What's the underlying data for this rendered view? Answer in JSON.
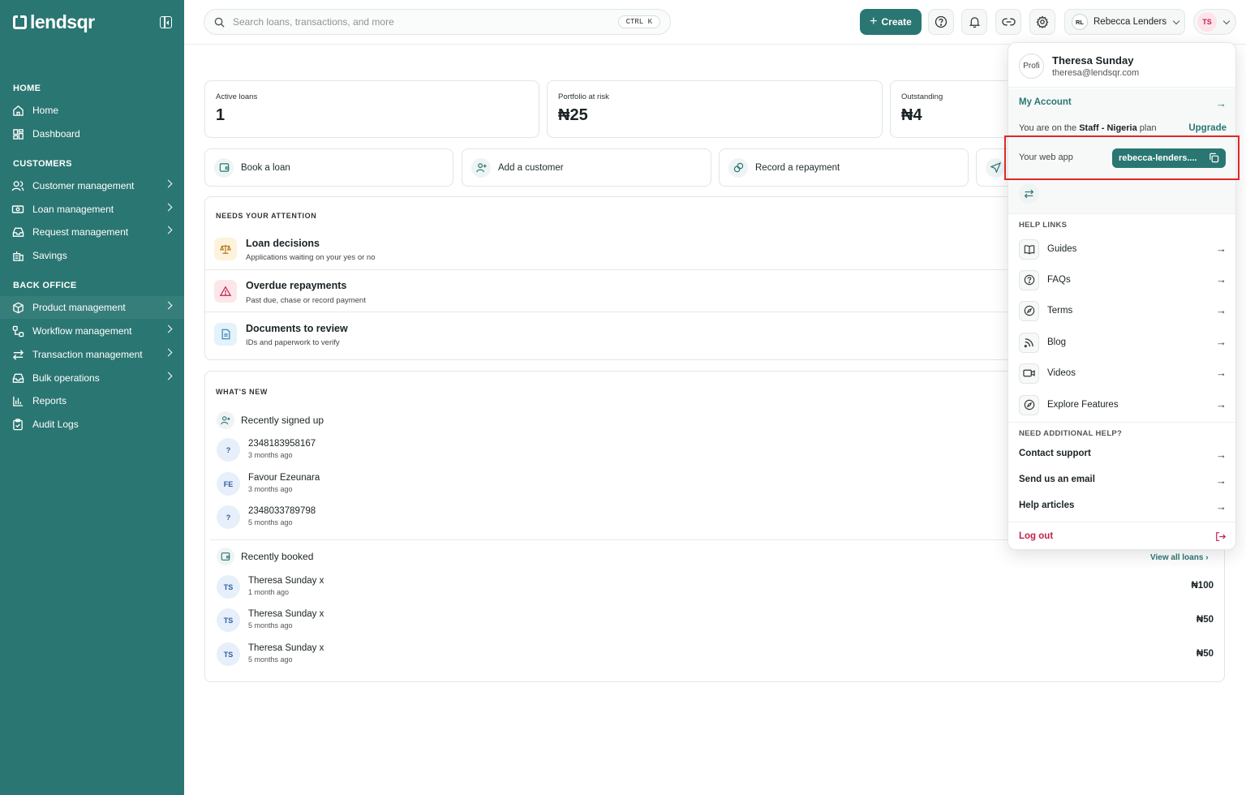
{
  "brand": {
    "name": "lendsqr"
  },
  "sidebar": {
    "sections": [
      {
        "title": "HOME",
        "items": [
          {
            "label": "Home"
          },
          {
            "label": "Dashboard"
          }
        ]
      },
      {
        "title": "CUSTOMERS",
        "items": [
          {
            "label": "Customer management"
          },
          {
            "label": "Loan management"
          },
          {
            "label": "Request management"
          },
          {
            "label": "Savings"
          }
        ]
      },
      {
        "title": "BACK OFFICE",
        "items": [
          {
            "label": "Product management"
          },
          {
            "label": "Workflow management"
          },
          {
            "label": "Transaction management"
          },
          {
            "label": "Bulk operations"
          },
          {
            "label": "Reports"
          },
          {
            "label": "Audit Logs"
          }
        ]
      }
    ]
  },
  "topbar": {
    "search_placeholder": "Search loans, transactions, and more",
    "shortcut": "CTRL K",
    "create_label": "Create",
    "org": {
      "initials": "RL",
      "name": "Rebecca Lenders"
    },
    "user": {
      "initials": "TS"
    }
  },
  "stats": [
    {
      "label": "Active loans",
      "value": "1"
    },
    {
      "label": "Portfolio at risk",
      "value": "₦25"
    },
    {
      "label": "Outstanding",
      "value": "₦4"
    }
  ],
  "quick_actions": [
    {
      "label": "Book a loan"
    },
    {
      "label": "Add a customer"
    },
    {
      "label": "Record a repayment"
    }
  ],
  "attention": {
    "title": "NEEDS YOUR ATTENTION",
    "items": [
      {
        "title": "Loan decisions",
        "subtitle": "Applications waiting on your yes or no"
      },
      {
        "title": "Overdue repayments",
        "subtitle": "Past due, chase or record payment"
      },
      {
        "title": "Documents to review",
        "subtitle": "IDs and paperwork to verify"
      }
    ]
  },
  "whats_new": {
    "title": "WHAT'S NEW",
    "signed_up_title": "Recently signed up",
    "signed_up": [
      {
        "initials": "?",
        "name": "2348183958167",
        "time": "3 months ago"
      },
      {
        "initials": "FE",
        "name": "Favour Ezeunara",
        "time": "3 months ago"
      },
      {
        "initials": "?",
        "name": "2348033789798",
        "time": "5 months ago"
      }
    ],
    "booked_title": "Recently booked",
    "view_all": "View all loans",
    "booked": [
      {
        "initials": "TS",
        "name": "Theresa Sunday x",
        "time": "1 month ago",
        "amount": "₦100"
      },
      {
        "initials": "TS",
        "name": "Theresa Sunday x",
        "time": "5 months ago",
        "amount": "₦50"
      },
      {
        "initials": "TS",
        "name": "Theresa Sunday x",
        "time": "5 months ago",
        "amount": "₦50"
      }
    ]
  },
  "dropdown": {
    "profile_alt": "Profi",
    "name": "Theresa Sunday",
    "email": "theresa@lendsqr.com",
    "my_account": "My Account",
    "plan_prefix": "You are on the ",
    "plan_name": "Staff - Nigeria",
    "plan_suffix": " plan",
    "upgrade": "Upgrade",
    "web_app_label": "Your web app",
    "web_app_value": "rebecca-lenders....",
    "help_links_title": "HELP LINKS",
    "help_links": [
      {
        "label": "Guides"
      },
      {
        "label": "FAQs"
      },
      {
        "label": "Terms"
      },
      {
        "label": "Blog"
      },
      {
        "label": "Videos"
      },
      {
        "label": "Explore Features"
      }
    ],
    "additional_title": "NEED ADDITIONAL HELP?",
    "additional": [
      {
        "label": "Contact support"
      },
      {
        "label": "Send us an email"
      },
      {
        "label": "Help articles"
      }
    ],
    "logout": "Log out"
  },
  "colors": {
    "primary": "#2a7672",
    "danger": "#c0234e",
    "highlight": "#e02828"
  }
}
